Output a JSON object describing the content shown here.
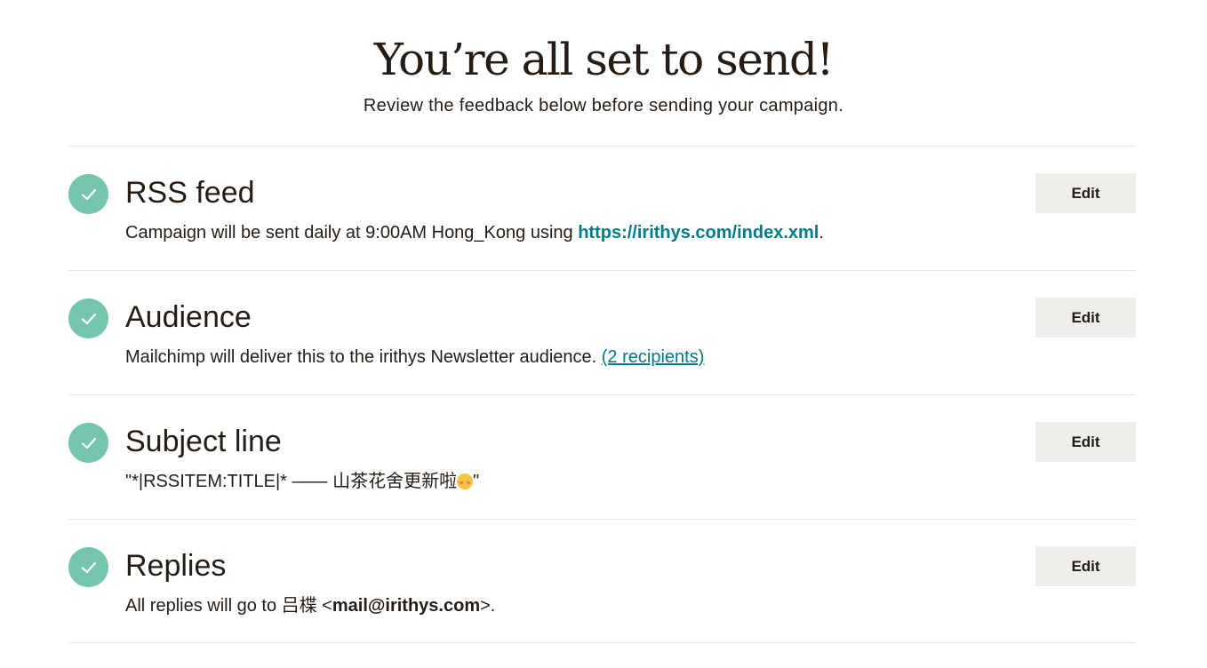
{
  "hero": {
    "title": "You’re all set to send!",
    "subtitle": "Review the feedback below before sending your campaign."
  },
  "colors": {
    "check": "#75c4ad",
    "link": "#007c89",
    "button_bg": "#efeeea",
    "text": "#241c15",
    "divider": "#e6e6e3"
  },
  "checklist": {
    "rss": {
      "icon": "check-circle-icon",
      "title": "RSS feed",
      "desc_before": "Campaign will be sent daily at 9:00AM Hong_Kong using ",
      "link": "https://irithys.com/index.xml",
      "desc_after": ".",
      "edit_label": "Edit"
    },
    "audience": {
      "icon": "check-circle-icon",
      "title": "Audience",
      "desc_before": "Mailchimp will deliver this to the irithys Newsletter audience. ",
      "link": "(2 recipients)",
      "edit_label": "Edit"
    },
    "subject": {
      "icon": "check-circle-icon",
      "title": "Subject line",
      "desc_before": "\"*|RSSITEM:TITLE|*  —— 山茶花舍更新啦",
      "emoji": "kissing-face-emoji",
      "desc_after": "\"",
      "edit_label": "Edit"
    },
    "replies": {
      "icon": "check-circle-icon",
      "title": "Replies",
      "desc_before": "All replies will go to 吕楪 <",
      "email": "mail@irithys.com",
      "desc_after": ">.",
      "edit_label": "Edit"
    }
  }
}
